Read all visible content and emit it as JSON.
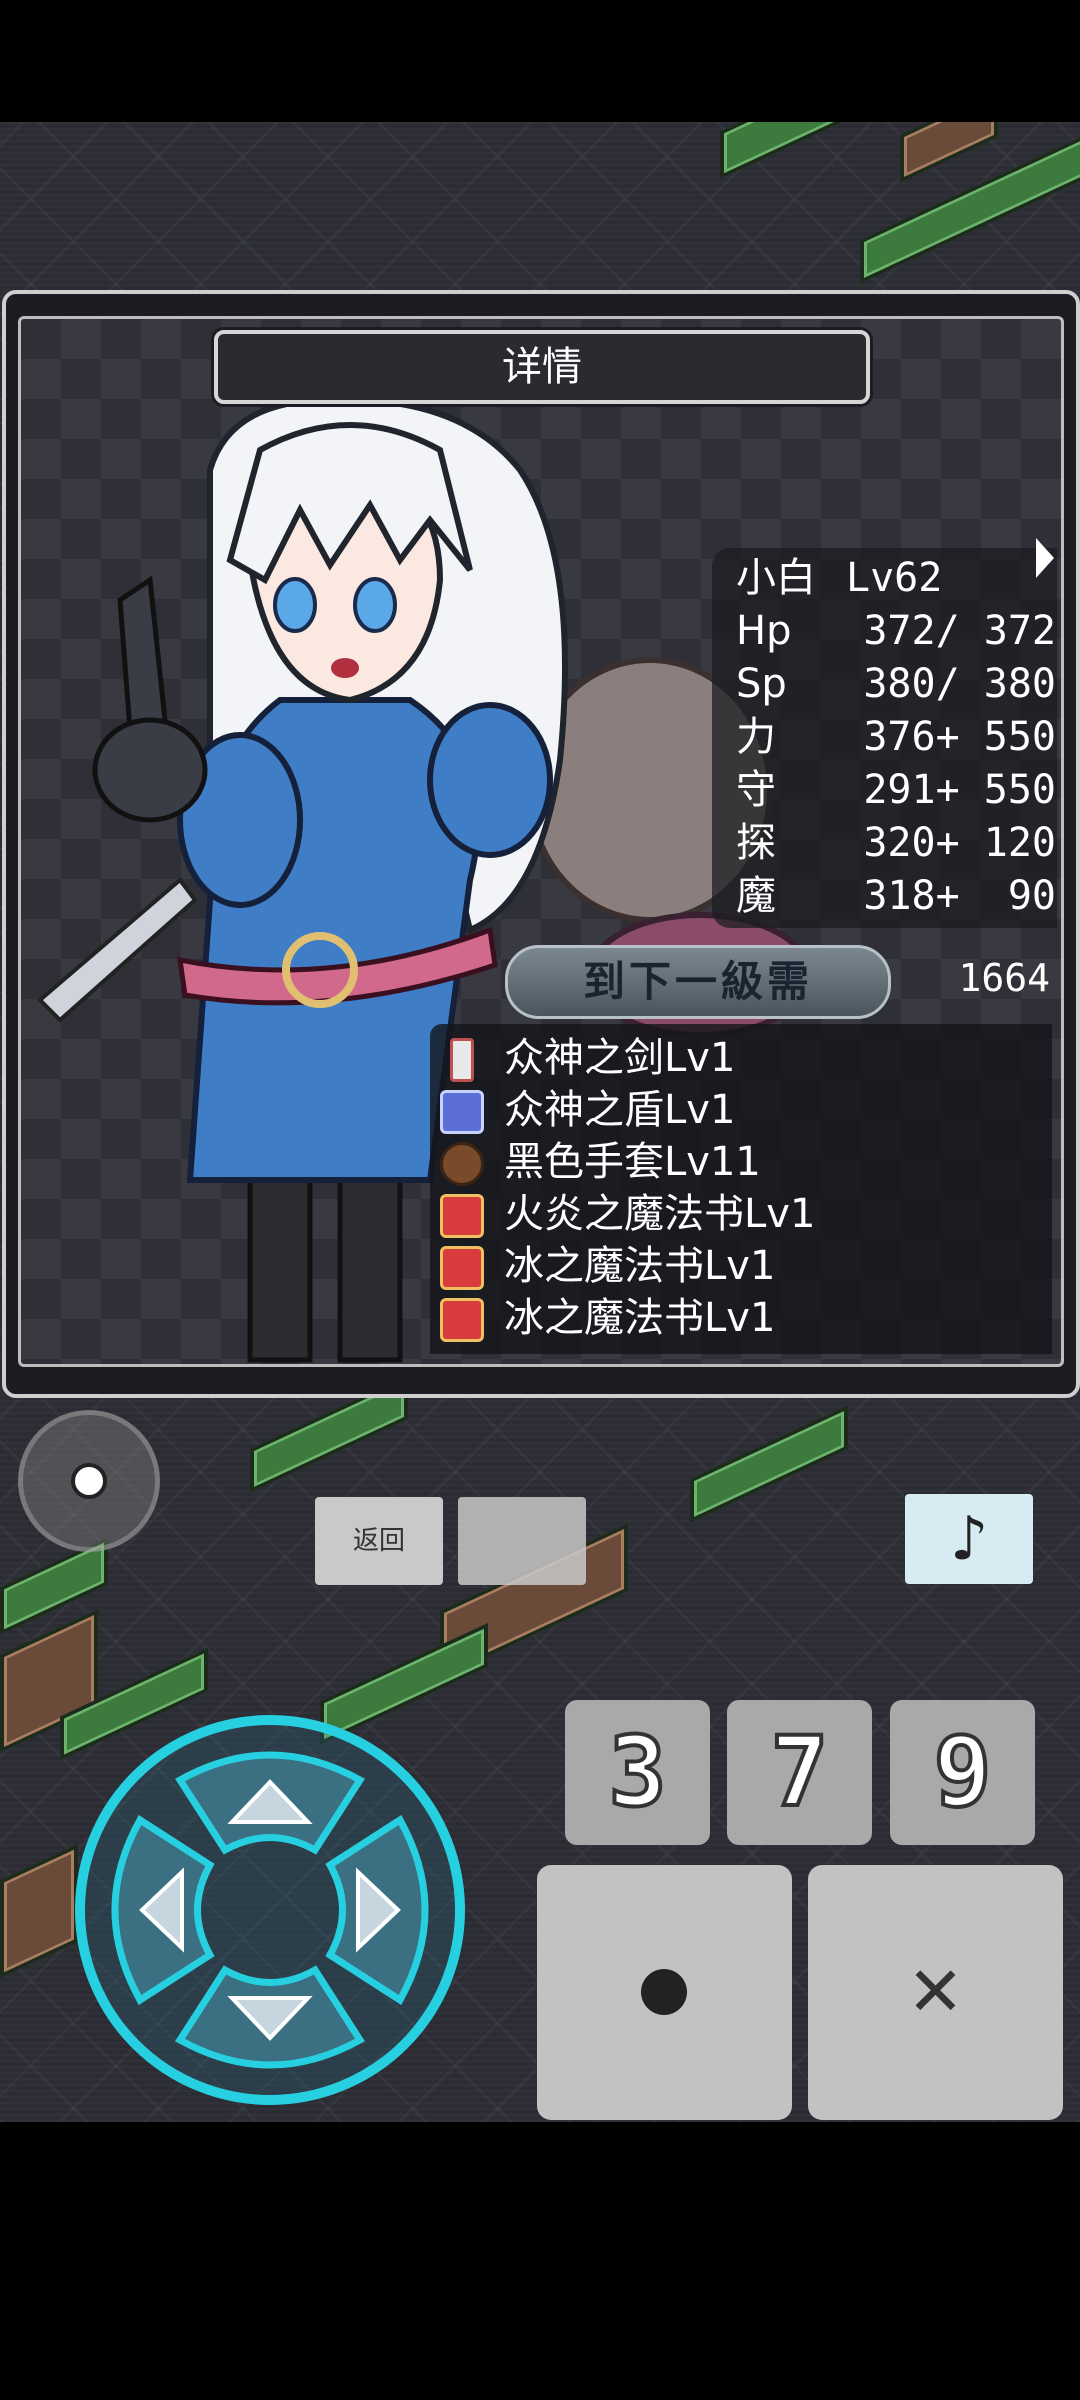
{
  "dialog": {
    "title": "详情"
  },
  "stats": {
    "name": "小白",
    "level": "Lv62",
    "rows": [
      {
        "label": "Hp",
        "value": "372/ 372"
      },
      {
        "label": "Sp",
        "value": "380/ 380"
      },
      {
        "label": "力",
        "value": "376+ 550"
      },
      {
        "label": "守",
        "value": "291+ 550"
      },
      {
        "label": "探",
        "value": "320+ 120"
      },
      {
        "label": "魔",
        "value": "318+  90"
      }
    ]
  },
  "next_level": {
    "label": "到下一級需",
    "value": "1664"
  },
  "equipment": [
    {
      "icon": "sword-icon",
      "name": "众神之剑Lv1"
    },
    {
      "icon": "shield-icon",
      "name": "众神之盾Lv1"
    },
    {
      "icon": "glove-icon",
      "name": "黑色手套Lv11"
    },
    {
      "icon": "spellbook-icon",
      "name": "火炎之魔法书Lv1"
    },
    {
      "icon": "spellbook-icon",
      "name": "冰之魔法书Lv1"
    },
    {
      "icon": "spellbook-icon",
      "name": "冰之魔法书Lv1"
    }
  ],
  "controls": {
    "back_label": "返回",
    "music_icon": "♪",
    "num_buttons": [
      "3",
      "7",
      "9"
    ],
    "cross_label": "✕"
  },
  "colors": {
    "dpad_glow": "#27d0e0",
    "music_button_bg": "#d6ecf2"
  }
}
